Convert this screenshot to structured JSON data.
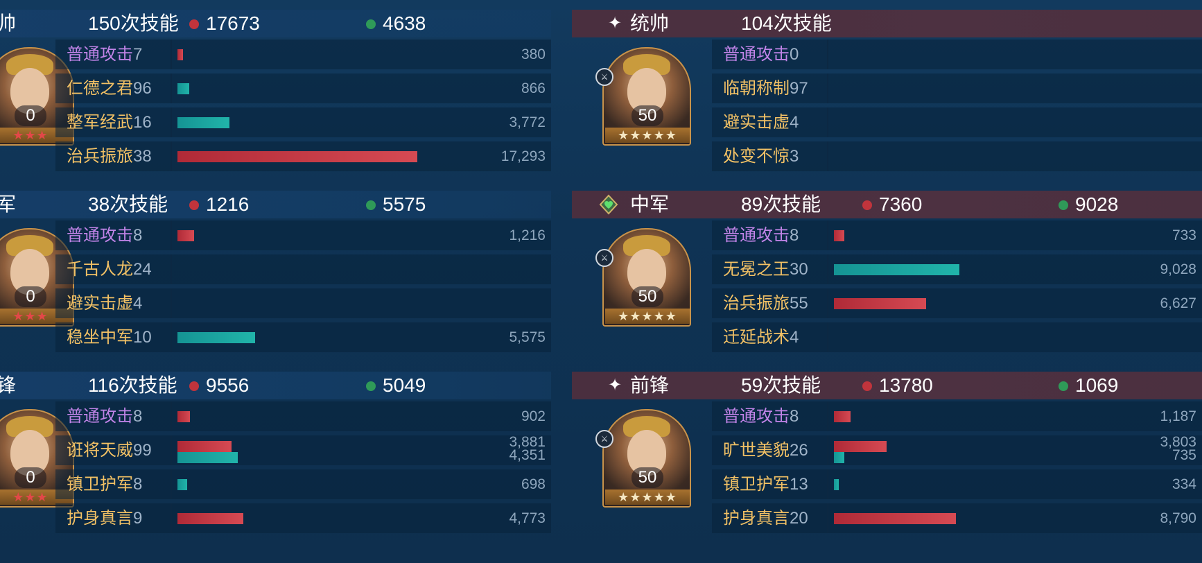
{
  "colors": {
    "normal_attack": "#c184e8",
    "skill": "#f2c165",
    "damage": "#c1343c",
    "heal": "#2f9a58",
    "bar_damage": "#c3333e",
    "bar_heal": "#1aa6a0"
  },
  "scale_max": 17293,
  "left": {
    "units": [
      {
        "position": "帅",
        "skill_count": "150次技能",
        "damage": "17673",
        "heal": "4638",
        "level": "0",
        "stars_red": 3,
        "stars_white": 0,
        "stars_star_icons": "★★★",
        "skills": [
          {
            "name": "普通攻击",
            "level": "7",
            "type": "normal",
            "bars": [
              {
                "kind": "damage",
                "value": 380,
                "label": "380"
              }
            ]
          },
          {
            "name": "仁德之君",
            "level": "96",
            "type": "skill",
            "bars": [
              {
                "kind": "heal",
                "value": 866,
                "label": "866"
              }
            ]
          },
          {
            "name": "整军经武",
            "level": "16",
            "type": "skill",
            "bars": [
              {
                "kind": "heal",
                "value": 3772,
                "label": "3,772"
              }
            ]
          },
          {
            "name": "治兵振旅",
            "level": "38",
            "type": "skill",
            "bars": [
              {
                "kind": "damage",
                "value": 17293,
                "label": "17,293"
              }
            ]
          }
        ]
      },
      {
        "position": "军",
        "skill_count": "38次技能",
        "damage": "1216",
        "heal": "5575",
        "level": "0",
        "stars_star_icons": "★★★",
        "skills": [
          {
            "name": "普通攻击",
            "level": "8",
            "type": "normal",
            "bars": [
              {
                "kind": "damage",
                "value": 1216,
                "label": "1,216"
              }
            ]
          },
          {
            "name": "千古人龙",
            "level": "24",
            "type": "skill",
            "bars": []
          },
          {
            "name": "避实击虚",
            "level": "4",
            "type": "skill",
            "bars": []
          },
          {
            "name": "稳坐中军",
            "level": "10",
            "type": "skill",
            "bars": [
              {
                "kind": "heal",
                "value": 5575,
                "label": "5,575"
              }
            ]
          }
        ]
      },
      {
        "position": "锋",
        "skill_count": "116次技能",
        "damage": "9556",
        "heal": "5049",
        "level": "0",
        "stars_star_icons": "★★★",
        "skills": [
          {
            "name": "普通攻击",
            "level": "8",
            "type": "normal",
            "bars": [
              {
                "kind": "damage",
                "value": 902,
                "label": "902"
              }
            ]
          },
          {
            "name": "诳将天威",
            "level": "99",
            "type": "skill",
            "bars": [
              {
                "kind": "damage",
                "value": 3881,
                "label": "3,881"
              },
              {
                "kind": "heal",
                "value": 4351,
                "label": "4,351"
              }
            ]
          },
          {
            "name": "镇卫护军",
            "level": "8",
            "type": "skill",
            "bars": [
              {
                "kind": "heal",
                "value": 698,
                "label": "698"
              }
            ]
          },
          {
            "name": "护身真言",
            "level": "9",
            "type": "skill",
            "bars": [
              {
                "kind": "damage",
                "value": 4773,
                "label": "4,773"
              }
            ]
          }
        ]
      }
    ]
  },
  "right": {
    "units": [
      {
        "position": "统帅",
        "position_icon": "sparkle-icon",
        "skill_count": "104次技能",
        "damage": "",
        "heal": "",
        "level": "50",
        "stars_star_icons": "★★★★★",
        "skills": [
          {
            "name": "普通攻击",
            "level": "0",
            "type": "normal",
            "bars": []
          },
          {
            "name": "临朝称制",
            "level": "97",
            "type": "skill",
            "bars": []
          },
          {
            "name": "避实击虚",
            "level": "4",
            "type": "skill",
            "bars": []
          },
          {
            "name": "处变不惊",
            "level": "3",
            "type": "skill",
            "bars": []
          }
        ]
      },
      {
        "position": "中军",
        "position_icon": "heart-shield-icon",
        "skill_count": "89次技能",
        "damage": "7360",
        "heal": "9028",
        "level": "50",
        "stars_star_icons": "★★★★★",
        "skills": [
          {
            "name": "普通攻击",
            "level": "8",
            "type": "normal",
            "bars": [
              {
                "kind": "damage",
                "value": 733,
                "label": "733"
              }
            ]
          },
          {
            "name": "无冕之王",
            "level": "30",
            "type": "skill",
            "bars": [
              {
                "kind": "heal",
                "value": 9028,
                "label": "9,028"
              }
            ]
          },
          {
            "name": "治兵振旅",
            "level": "55",
            "type": "skill",
            "bars": [
              {
                "kind": "damage",
                "value": 6627,
                "label": "6,627"
              }
            ]
          },
          {
            "name": "迁延战术",
            "level": "4",
            "type": "skill",
            "bars": []
          }
        ]
      },
      {
        "position": "前锋",
        "position_icon": "sparkle-icon",
        "skill_count": "59次技能",
        "damage": "13780",
        "heal": "1069",
        "level": "50",
        "stars_star_icons": "★★★★★",
        "skills": [
          {
            "name": "普通攻击",
            "level": "8",
            "type": "normal",
            "bars": [
              {
                "kind": "damage",
                "value": 1187,
                "label": "1,187"
              }
            ]
          },
          {
            "name": "旷世美貌",
            "level": "26",
            "type": "skill",
            "bars": [
              {
                "kind": "damage",
                "value": 3803,
                "label": "3,803"
              },
              {
                "kind": "heal",
                "value": 735,
                "label": "735"
              }
            ]
          },
          {
            "name": "镇卫护军",
            "level": "13",
            "type": "skill",
            "bars": [
              {
                "kind": "heal",
                "value": 334,
                "label": "334"
              }
            ]
          },
          {
            "name": "护身真言",
            "level": "20",
            "type": "skill",
            "bars": [
              {
                "kind": "damage",
                "value": 8790,
                "label": "8,790"
              }
            ]
          }
        ]
      }
    ]
  }
}
